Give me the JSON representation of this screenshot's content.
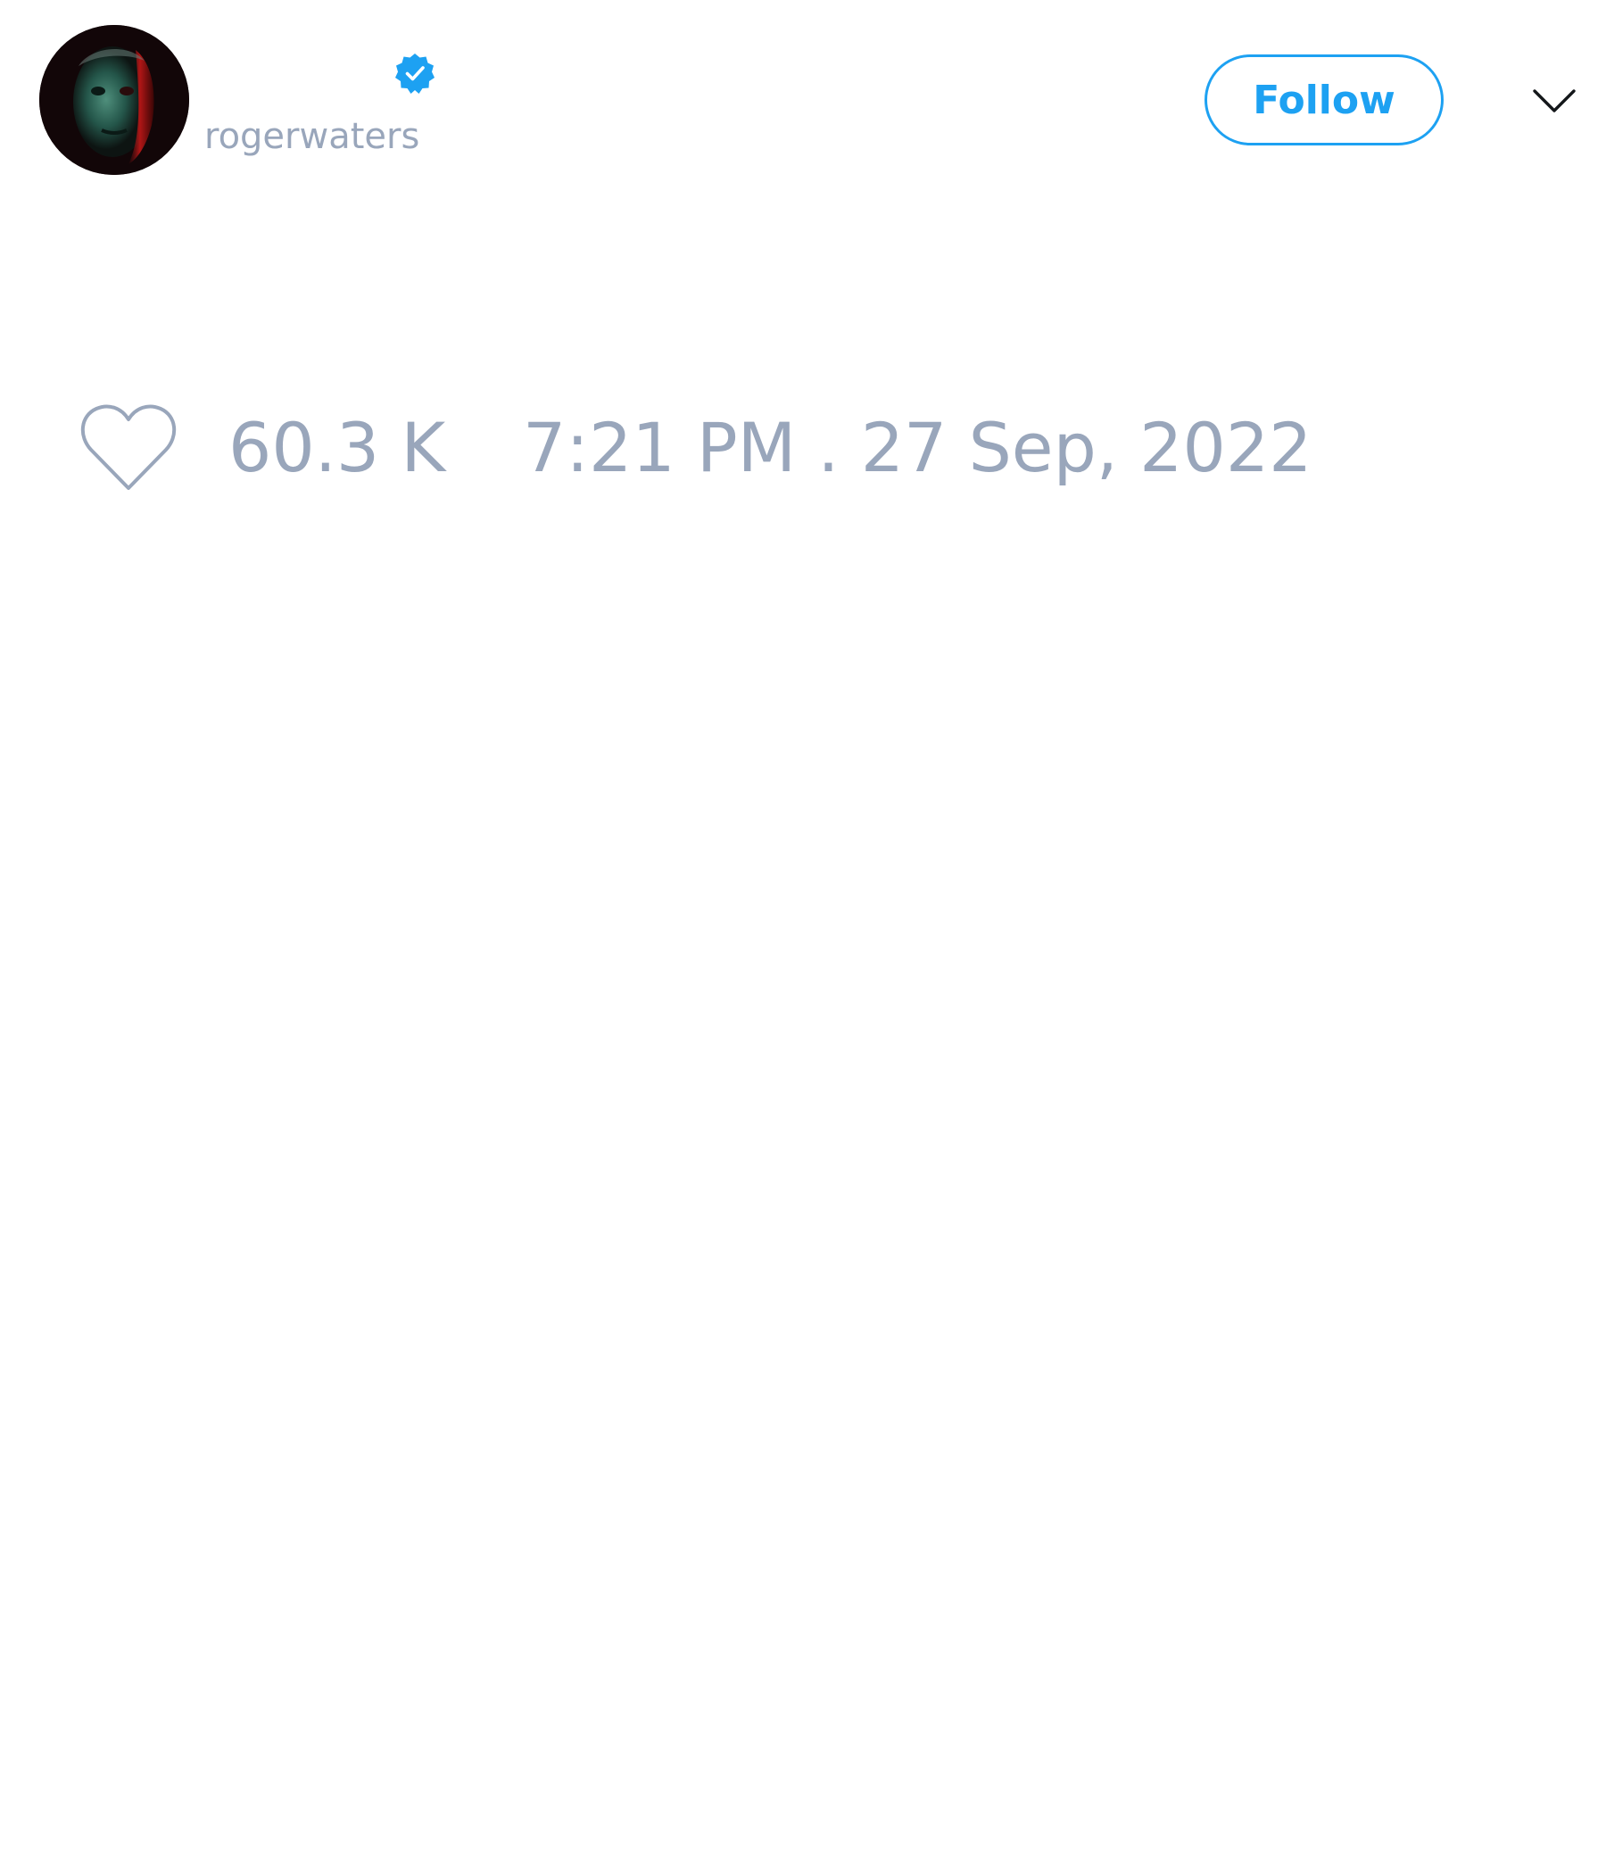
{
  "author": {
    "display_name": "",
    "handle": "rogerwaters",
    "verified": true,
    "avatar": "avatar-portrait"
  },
  "actions": {
    "follow_label": "Follow",
    "more_icon": "chevron-down-icon"
  },
  "engagement": {
    "like_icon": "heart-outline-icon",
    "like_count": "60.3 K"
  },
  "timestamp": "7:21 PM . 27 Sep, 2022",
  "colors": {
    "accent": "#1da1f2",
    "muted_text": "#99a6bb",
    "background": "#ffffff",
    "icon_dark": "#14171a"
  }
}
